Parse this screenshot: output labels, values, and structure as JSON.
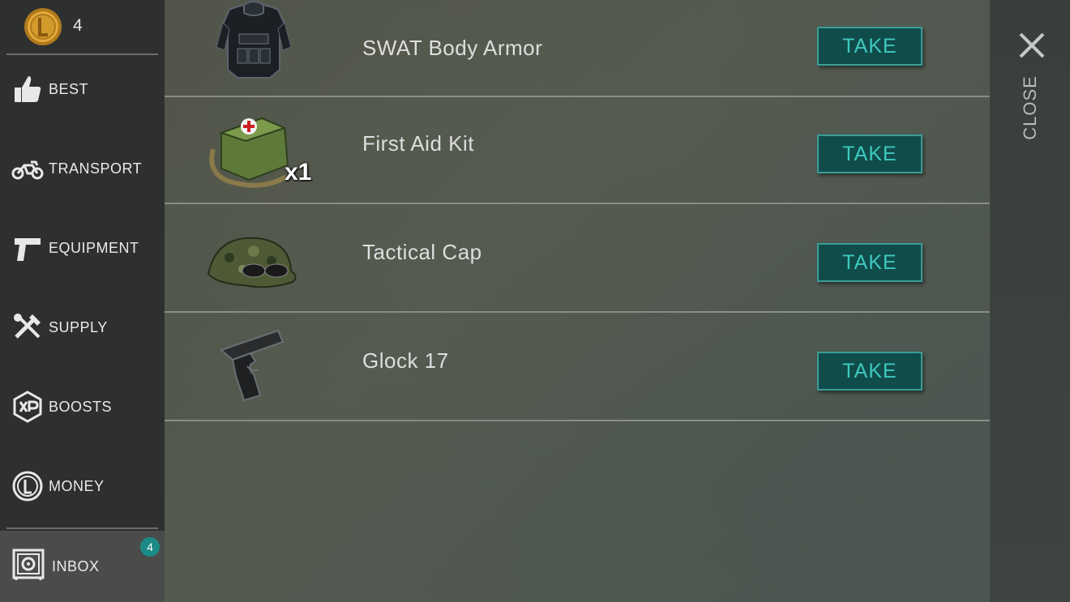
{
  "wallet": {
    "coin_icon": "coin-icon",
    "coin_count": "4"
  },
  "sidebar": {
    "items": [
      {
        "label": "BEST",
        "icon": "thumbs-up-icon"
      },
      {
        "label": "TRANSPORT",
        "icon": "motorcycle-icon"
      },
      {
        "label": "EQUIPMENT",
        "icon": "pistol-icon"
      },
      {
        "label": "SUPPLY",
        "icon": "tools-icon"
      },
      {
        "label": "BOOSTS",
        "icon": "xp-badge-icon"
      },
      {
        "label": "MONEY",
        "icon": "coin-icon"
      }
    ],
    "inbox": {
      "label": "INBOX",
      "badge": "4",
      "icon": "safe-icon",
      "selected": true
    }
  },
  "inbox_items": [
    {
      "name": "SWAT Body Armor",
      "image": "body-armor-image",
      "quantity": "",
      "action": "TAKE"
    },
    {
      "name": "First Aid Kit",
      "image": "first-aid-kit-image",
      "quantity": "x1",
      "action": "TAKE"
    },
    {
      "name": "Tactical Cap",
      "image": "tactical-cap-image",
      "quantity": "",
      "action": "TAKE"
    },
    {
      "name": "Glock 17",
      "image": "pistol-image",
      "quantity": "",
      "action": "TAKE"
    }
  ],
  "close": {
    "label": "CLOSE",
    "icon": "close-icon"
  },
  "colors": {
    "sidebar_bg": "#2e302f",
    "inbox_selected_bg": "#4a4c4a",
    "badge": "#1c8b88",
    "button_bg": "#104c4a",
    "button_border": "#3a9e98",
    "button_text": "#3ec9bf"
  }
}
